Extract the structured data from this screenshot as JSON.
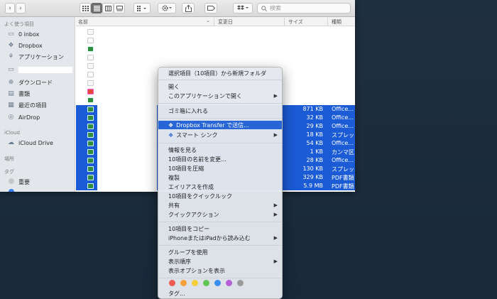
{
  "toolbar": {
    "back": "‹",
    "forward": "›",
    "search_placeholder": "検索"
  },
  "sidebar": {
    "favorites_header": "よく使う項目",
    "favorites": [
      {
        "label": "0 inbox",
        "icon": "folder-icon"
      },
      {
        "label": "Dropbox",
        "icon": "dropbox-icon"
      },
      {
        "label": "アプリケーション",
        "icon": "applications-icon"
      },
      {
        "label": "",
        "icon": "folder-icon"
      },
      {
        "label": "ダウンロード",
        "icon": "download-icon"
      },
      {
        "label": "書類",
        "icon": "documents-icon"
      },
      {
        "label": "最近の項目",
        "icon": "recents-icon"
      },
      {
        "label": "AirDrop",
        "icon": "airdrop-icon"
      }
    ],
    "icloud_header": "iCloud",
    "icloud_drive": "iCloud Drive",
    "places_header": "場所",
    "tags_header": "タグ",
    "tag_important": "重要"
  },
  "columns": {
    "name": "名前",
    "modified": "変更日",
    "size": "サイズ",
    "kind": "種類"
  },
  "files": [
    {
      "size": "871 KB",
      "kind": "Office..."
    },
    {
      "size": "32 KB",
      "kind": "Office..."
    },
    {
      "size": "29 KB",
      "kind": "Office..."
    },
    {
      "size": "18 KB",
      "kind": "スプレッ"
    },
    {
      "size": "54 KB",
      "kind": "Office..."
    },
    {
      "size": "1 KB",
      "kind": "カンマ区"
    },
    {
      "size": "28 KB",
      "kind": "Office..."
    },
    {
      "size": "130 KB",
      "kind": "スプレッ"
    },
    {
      "size": "329 KB",
      "kind": "PDF書類"
    },
    {
      "size": "5.9 MB",
      "kind": "PDF書類"
    }
  ],
  "menu": {
    "new_folder": "選択項目（10項目）から新規フォルダ",
    "open": "開く",
    "open_with": "このアプリケーションで開く",
    "trash": "ゴミ箱に入れる",
    "dropbox_transfer": "Dropbox Transfer で送信...",
    "smart_sync": "スマート シンク",
    "get_info": "情報を見る",
    "rename": "10項目の名前を変更...",
    "compress": "10項目を圧縮",
    "duplicate": "複製",
    "alias": "エイリアスを作成",
    "quicklook": "10項目をクイックルック",
    "share": "共有",
    "quick_actions": "クイックアクション",
    "copy": "10項目をコピー",
    "import_iphone": "iPhoneまたはiPadから読み込む",
    "use_groups": "グループを使用",
    "sort_by": "表示順序",
    "view_options": "表示オプションを表示",
    "tags": "タグ..."
  },
  "tag_colors": [
    "#ef5a52",
    "#f5a03a",
    "#f4cf3a",
    "#5fc653",
    "#3a8df0",
    "#b65fd6",
    "#9a9a9a"
  ],
  "accent": "#2866d8"
}
